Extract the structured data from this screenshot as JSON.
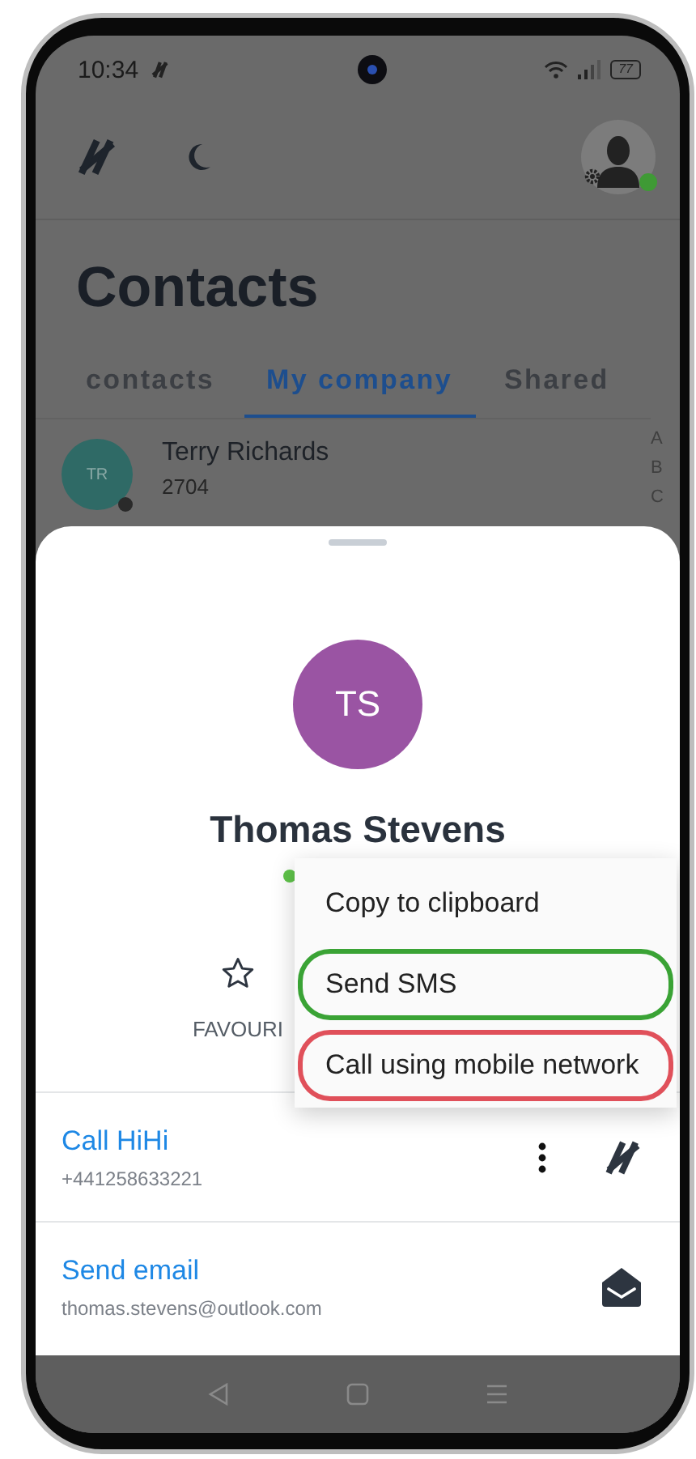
{
  "status_bar": {
    "time": "10:34",
    "battery": "77"
  },
  "header": {
    "avatar_online": true
  },
  "title": "Contacts",
  "tabs": [
    {
      "label": "contacts",
      "selected": false
    },
    {
      "label": "My company",
      "selected": true
    },
    {
      "label": "Shared",
      "selected": false
    }
  ],
  "contacts": [
    {
      "initials": "TR",
      "name": "Terry Richards",
      "number": "2704",
      "color": "#2f6a66",
      "online": false
    }
  ],
  "index_letters": [
    "A",
    "B",
    "C"
  ],
  "sheet": {
    "initials": "TS",
    "name": "Thomas Stevens",
    "status_online": true,
    "favourite_label": "FAVOURI",
    "favourite": false,
    "actions": [
      {
        "kind": "call",
        "title": "Call HiHi",
        "detail": "+441258633221"
      },
      {
        "kind": "email",
        "title": "Send email",
        "detail": "thomas.stevens@outlook.com"
      }
    ]
  },
  "menu": [
    {
      "label": "Copy to clipboard"
    },
    {
      "label": "Send SMS",
      "color": "#3aa335"
    },
    {
      "label": "Call using mobile network",
      "color": "#e0505a"
    }
  ]
}
